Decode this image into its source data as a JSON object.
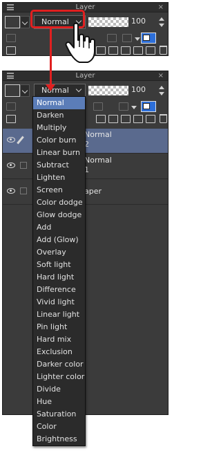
{
  "panel": {
    "title": "Layer",
    "close": "×",
    "blend_mode": "Normal",
    "opacity": "100"
  },
  "layers": [
    {
      "line1": "Normal",
      "line2": "2",
      "selected": true
    },
    {
      "line1": "Normal",
      "line2": "1",
      "selected": false
    },
    {
      "line1": "aper",
      "line2": "",
      "selected": false
    }
  ],
  "blend_menu": {
    "selected": "Normal",
    "options": [
      "Normal",
      "Darken",
      "Multiply",
      "Color burn",
      "Linear burn",
      "Subtract",
      "Lighten",
      "Screen",
      "Color dodge",
      "Glow dodge",
      "Add",
      "Add (Glow)",
      "Overlay",
      "Soft light",
      "Hard light",
      "Difference",
      "Vivid light",
      "Linear light",
      "Pin light",
      "Hard mix",
      "Exclusion",
      "Darker color",
      "Lighter color",
      "Divide",
      "Hue",
      "Saturation",
      "Color",
      "Brightness"
    ]
  },
  "colors": {
    "annotation": "#e02020",
    "selection": "#5b7db8",
    "selected_layer": "#5a6a8e",
    "panel_bg": "#3b3b3b"
  },
  "icons": [
    "hamburger-menu-icon",
    "chevron-down-icon",
    "pointer-hand-cursor-icon",
    "eye-icon",
    "pen-icon",
    "trash-icon",
    "layer-color-icon"
  ]
}
